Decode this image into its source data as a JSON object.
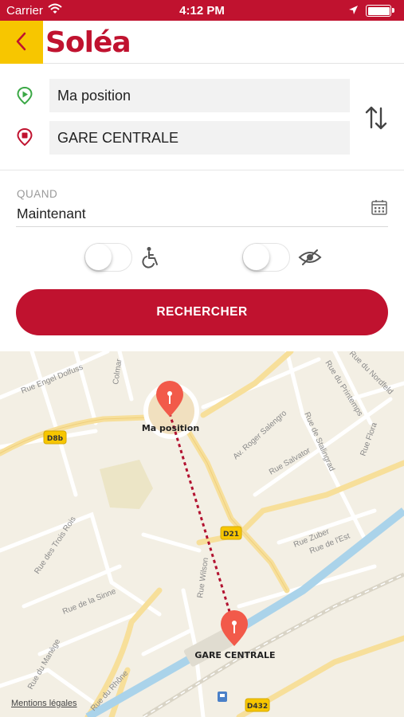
{
  "status_bar": {
    "carrier": "Carrier",
    "time": "4:12 PM"
  },
  "header": {
    "logo": "Soléa",
    "back_icon": "chevron-left-icon"
  },
  "route": {
    "from_value": "Ma position",
    "to_value": "GARE CENTRALE",
    "from_icon": "origin-pin-icon",
    "to_icon": "destination-pin-icon",
    "swap_icon": "swap-arrows-icon"
  },
  "when": {
    "label": "QUAND",
    "value": "Maintenant",
    "icon": "calendar-icon"
  },
  "options": {
    "accessibility": {
      "icon": "wheelchair-icon",
      "enabled": false
    },
    "visibility": {
      "icon": "eye-slash-icon",
      "enabled": false
    }
  },
  "search_button": {
    "label": "RECHERCHER"
  },
  "map": {
    "streets": [
      "Rue Engel Dolfuss",
      "Colmar",
      "Rue du Nordfeld",
      "Rue du Printemps",
      "Av. Roger Salengro",
      "Rue de Stalingrad",
      "Rue Salvator",
      "Rue Flora",
      "Rue des Trois Rois",
      "Rue de la Sinne",
      "Rue Wilson",
      "Rue Zuber",
      "Rue de l'Est",
      "Rue du Manège",
      "Rue du Rhône"
    ],
    "road_badges": [
      "D8b",
      "D21",
      "D432"
    ],
    "origin_label": "Ma position",
    "destination_label": "GARE CENTRALE",
    "mentions": "Mentions légales"
  },
  "colors": {
    "brand_red": "#c0122f",
    "back_yellow": "#f7c600",
    "origin_green": "#3aa845",
    "pin_coral": "#f25a4a"
  }
}
